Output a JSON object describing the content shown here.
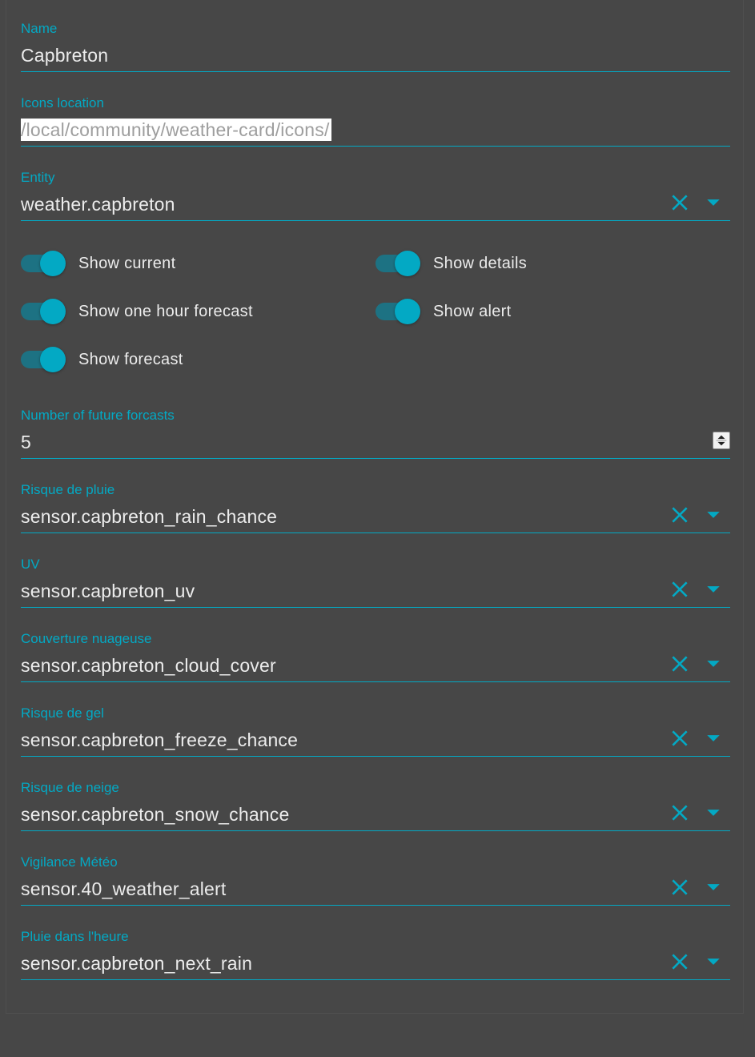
{
  "fields": {
    "name": {
      "label": "Name",
      "value": "Capbreton"
    },
    "icons_location": {
      "label": "Icons location",
      "value": "/local/community/weather-card/icons/"
    },
    "entity": {
      "label": "Entity",
      "value": "weather.capbreton"
    },
    "number_of_forecasts": {
      "label": "Number of future forcasts",
      "value": "5"
    },
    "rain_chance": {
      "label": "Risque de pluie",
      "value": "sensor.capbreton_rain_chance"
    },
    "uv": {
      "label": "UV",
      "value": "sensor.capbreton_uv"
    },
    "cloud_cover": {
      "label": "Couverture nuageuse",
      "value": "sensor.capbreton_cloud_cover"
    },
    "freeze_chance": {
      "label": "Risque de gel",
      "value": "sensor.capbreton_freeze_chance"
    },
    "snow_chance": {
      "label": "Risque de neige",
      "value": "sensor.capbreton_snow_chance"
    },
    "weather_alert": {
      "label": "Vigilance Météo",
      "value": "sensor.40_weather_alert"
    },
    "next_rain": {
      "label": "Pluie dans l'heure",
      "value": "sensor.capbreton_next_rain"
    }
  },
  "toggles": {
    "show_current": {
      "label": "Show current",
      "checked": true
    },
    "show_details": {
      "label": "Show details",
      "checked": true
    },
    "show_one_hour_forecast": {
      "label": "Show one hour forecast",
      "checked": true
    },
    "show_alert": {
      "label": "Show alert",
      "checked": true
    },
    "show_forecast": {
      "label": "Show forecast",
      "checked": true
    }
  },
  "icons": {
    "clear": "close-x-icon",
    "dropdown": "caret-down-icon",
    "spinner": "number-spinner-icon"
  },
  "colors": {
    "accent": "#03a9c4",
    "background": "#474747",
    "text": "#ececec",
    "switch_track": "#1d7283"
  }
}
